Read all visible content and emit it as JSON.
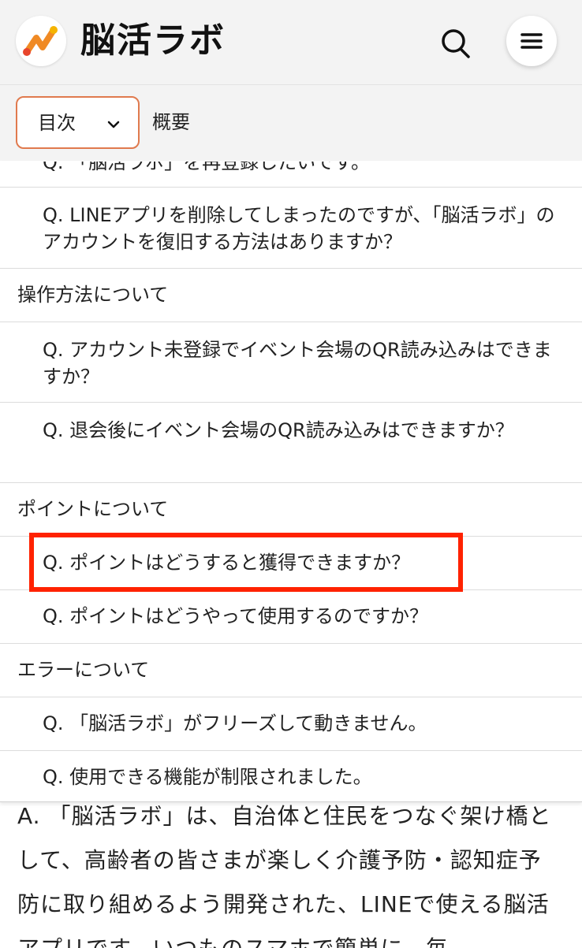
{
  "header": {
    "logo_text": "脳活ラボ",
    "search_icon": "search-icon",
    "menu_icon": "hamburger-menu-icon"
  },
  "toc": {
    "select_label": "目次",
    "overview_label": "概要",
    "items": [
      {
        "type": "sub",
        "text": "Q. 「脳活ラボ」を再登録したいです。"
      },
      {
        "type": "sub",
        "text": "Q. LINEアプリを削除してしまったのですが、「脳活ラボ」のアカウントを復旧する方法はありますか？"
      },
      {
        "type": "section",
        "text": "操作方法について"
      },
      {
        "type": "sub",
        "text": "Q. アカウント未登録でイベント会場のQR読み込みはできますか？"
      },
      {
        "type": "sub",
        "text": "Q. 退会後にイベント会場のQR読み込みはできますか？"
      },
      {
        "type": "section",
        "text": "ポイントについて"
      },
      {
        "type": "sub",
        "text": "Q. ポイントはどうすると獲得できますか？"
      },
      {
        "type": "sub",
        "text": "Q. ポイントはどうやって使用するのですか？"
      },
      {
        "type": "section",
        "text": "エラーについて"
      },
      {
        "type": "sub",
        "text": "Q. 「脳活ラボ」がフリーズして動きません。"
      },
      {
        "type": "sub",
        "text": "Q. 使用できる機能が制限されました。"
      }
    ]
  },
  "body": {
    "text": "A. 「脳活ラボ」は、自治体と住民をつなぐ架け橋として、高齢者の皆さまが楽しく介護予防・認知症予防に取り組めるよう開発された、LINEで使える脳活アプリです。いつものスマホで簡単に、毎"
  },
  "colors": {
    "accent": "#e07a4e",
    "highlight": "#ff2200",
    "logo_orange": "#f08a24",
    "logo_red": "#e8452c"
  }
}
